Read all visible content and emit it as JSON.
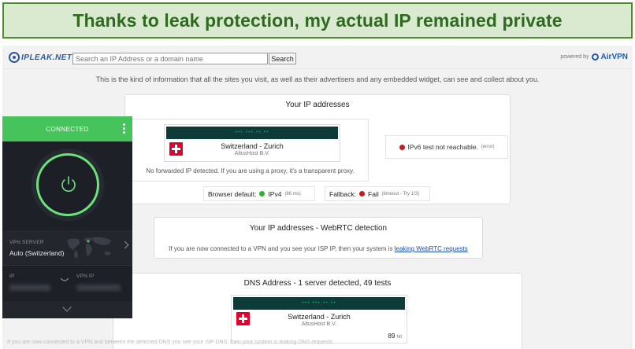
{
  "banner": {
    "text": "Thanks to leak protection, my actual IP remained private"
  },
  "site": {
    "logo_text": "IPLEAK.NET",
    "search": {
      "placeholder": "Search an IP Address or a domain name",
      "button_label": "Search"
    },
    "powered_by": "powered by",
    "airvpn_label": "AirVPN",
    "intro": "This is the kind of information that all the sites you visit, as well as their advertisers and any embedded widget, can see and collect about you."
  },
  "ip_section": {
    "title": "Your IP addresses",
    "address_masked": "•••.•••.••.••",
    "location": "Switzerland - Zurich",
    "isp": "AltusHost B.V.",
    "proxy_note": "No forwarded IP detected. If you are using a proxy, it's a transparent proxy.",
    "ipv6_text": "IPv6 test not reachable.",
    "ipv6_note": "(error)",
    "browser_default_label": "Browser default:",
    "browser_default_value": "IPv4",
    "browser_default_ms": "(86 ms)",
    "fallback_label": "Fallback:",
    "fallback_value": "Fail",
    "fallback_note": "(timeout - Try 1/3)"
  },
  "webrtc_section": {
    "title": "Your IP addresses - WebRTC detection",
    "note": "If you are now connected to a VPN and you see your ISP IP, then your system is",
    "link_text": "leaking WebRTC requests"
  },
  "dns_section": {
    "title": "DNS Address - 1 server detected, 49 tests",
    "address_masked": "•••.•••.••.••",
    "location": "Switzerland - Zurich",
    "isp": "AltusHost B.V.",
    "hits_value": "89",
    "hits_label": "hit",
    "bottom_text": "If you are now connected to a VPN and between the detected DNS you see your ISP DNS, then your system is leaking DNS requests"
  },
  "vpn_app": {
    "status": "CONNECTED",
    "server_label": "VPN SERVER",
    "server_value": "Auto (Switzerland)",
    "ip_label": "IP",
    "vpn_ip_label": "VPN IP",
    "accent_color": "#46c35a"
  }
}
